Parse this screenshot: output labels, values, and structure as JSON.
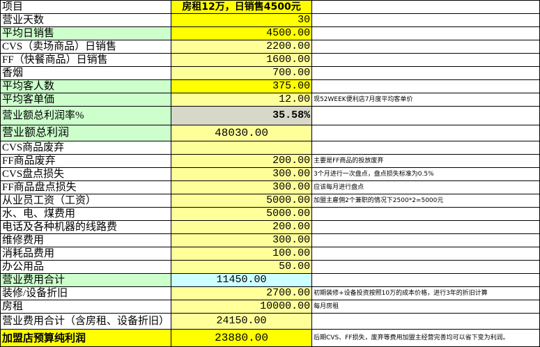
{
  "header": {
    "item": "项目",
    "scenario": "房租12万，日销售4500元"
  },
  "rows": [
    {
      "label": "营业天数",
      "value": "30",
      "note": ""
    },
    {
      "label": "平均日销售",
      "value": "4500.00",
      "note": ""
    },
    {
      "label": "CVS（卖场商品）日销售",
      "value": "2200.00",
      "note": ""
    },
    {
      "label": "FF（快餐商品）日销售",
      "value": "1600.00",
      "note": ""
    },
    {
      "label": "香烟",
      "value": "700.00",
      "note": ""
    },
    {
      "label": "平均客人数",
      "value": "375.00",
      "note": ""
    },
    {
      "label": "平均客单価",
      "value": "12.00",
      "note": "现52WEEK便利店7月度平均客单价"
    },
    {
      "label": "营业额总利润率%",
      "value": "35.58%",
      "note": ""
    },
    {
      "label": "营业额总利润",
      "value": "48030.00",
      "note": ""
    },
    {
      "label": "CVS商品废弃",
      "value": "",
      "note": ""
    },
    {
      "label": "FF商品废弃",
      "value": "200.00",
      "note": "主要是FF商品的投放废弃"
    },
    {
      "label": "CVS盘点损失",
      "value": "300.00",
      "note": "3个月进行一次盘点，盘点损失标准为0.5%"
    },
    {
      "label": "FF商品盘点损失",
      "value": "300.00",
      "note": "应该每月进行盘点"
    },
    {
      "label": "从业员工资（工资）",
      "value": "5000.00",
      "note": "加盟主雇佣2个兼职的情况下2500*2=5000元"
    },
    {
      "label": "水、电、煤费用",
      "value": "5000.00",
      "note": ""
    },
    {
      "label": "电话及各种机器的线路费",
      "value": "200.00",
      "note": ""
    },
    {
      "label": "维修费用",
      "value": "300.00",
      "note": ""
    },
    {
      "label": "消耗品费用",
      "value": "100.00",
      "note": ""
    },
    {
      "label": "办公用品",
      "value": "50.00",
      "note": ""
    },
    {
      "label": "营业费用合计",
      "value": "11450.00",
      "note": ""
    },
    {
      "label": "装修/设备折旧",
      "value": "2700.00",
      "note": "初期装修+设备投资按照10万的成本价格，进行3年的折旧计算"
    },
    {
      "label": "房租",
      "value": "10000.00",
      "note": "每月房租"
    },
    {
      "label": "营业费用合计（含房租、设备折旧）",
      "value": "24150.00",
      "note": ""
    },
    {
      "label": "加盟店预算纯利润",
      "value": "23880.00",
      "note": "后期CVS、FF损失，废弃等费用加盟主经营完善均可以省下变为利润。"
    }
  ],
  "colors": {
    "value_fill": "#ffff99",
    "header_fill": "#ffff00",
    "green_fill": "#ccffcc",
    "cyan_fill": "#ccffff"
  }
}
